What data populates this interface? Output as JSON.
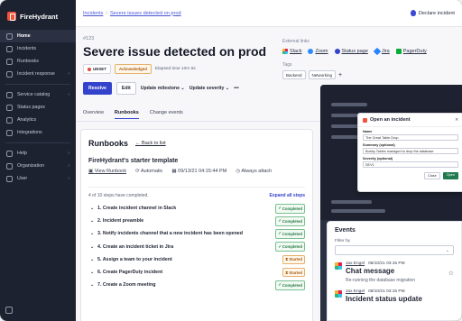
{
  "brand": {
    "name": "FireHydrant"
  },
  "sidebar": {
    "items": [
      {
        "label": "Home",
        "chevron": false,
        "active": true,
        "icon": "home-icon"
      },
      {
        "label": "Incidents",
        "chevron": false,
        "active": false,
        "icon": "incidents-icon"
      },
      {
        "label": "Runbooks",
        "chevron": false,
        "active": false,
        "icon": "runbooks-icon"
      },
      {
        "label": "Incident response",
        "chevron": true,
        "active": false,
        "icon": "response-icon"
      },
      {
        "label": "Service catalog",
        "chevron": true,
        "active": false,
        "icon": "catalog-icon"
      },
      {
        "label": "Status pages",
        "chevron": false,
        "active": false,
        "icon": "status-pages-icon"
      },
      {
        "label": "Analytics",
        "chevron": false,
        "active": false,
        "icon": "analytics-icon"
      },
      {
        "label": "Integrations",
        "chevron": false,
        "active": false,
        "icon": "integrations-icon"
      },
      {
        "label": "Help",
        "chevron": true,
        "active": false,
        "icon": "help-icon"
      },
      {
        "label": "Organization",
        "chevron": true,
        "active": false,
        "icon": "organization-icon"
      },
      {
        "label": "User",
        "chevron": true,
        "active": false,
        "icon": "user-icon"
      }
    ]
  },
  "topbar": {
    "crumb_root": "Incidents",
    "crumb_sep": "/",
    "crumb_current": "Severe issues detected on prod",
    "declare_label": "Declare incident"
  },
  "incident": {
    "number": "#123",
    "title": "Severe issue detected on prod",
    "severity": "UNSET",
    "status": "Acknowledged",
    "elapsed": "Elapsed time 10m 5s"
  },
  "actions": {
    "resolve": "Resolve",
    "edit": "Edit",
    "milestone": "Update milestone",
    "severity": "Update severity",
    "more": "•••"
  },
  "external": {
    "title": "External links",
    "links": [
      "Slack",
      "Zoom",
      "Status page",
      "Jira",
      "PagerDuty"
    ],
    "tags_title": "Tags",
    "tags": [
      "Backend",
      "Networking"
    ],
    "add": "+"
  },
  "tabs": [
    "Overview",
    "Runbooks",
    "Change events"
  ],
  "runbook": {
    "card_title": "Runbooks",
    "back": "Back to list",
    "name": "FireHydrant's starter template",
    "view": "View Runbook",
    "mode": "Automatic",
    "date": "09/13/21 04:15:44 PM",
    "attach": "Always attach",
    "progress": "4 of 10 steps have completed.",
    "expand": "Expand all steps",
    "steps": [
      {
        "label": "1. Create incident channel in Slack",
        "status": "Completed"
      },
      {
        "label": "2. Incident preamble",
        "status": "Completed"
      },
      {
        "label": "3. Notify incidents channel that a new incident has been opened",
        "status": "Completed"
      },
      {
        "label": "4. Create an incident ticket in Jira",
        "status": "Completed"
      },
      {
        "label": "5. Assign a team to your incident",
        "status": "Started"
      },
      {
        "label": "6. Create PagerDuty incident",
        "status": "Started"
      },
      {
        "label": "7. Create a Zoom meeting",
        "status": "Completed"
      }
    ]
  },
  "modal": {
    "title": "Open an incident",
    "name_label": "Name",
    "name_value": "The Great Table Drop",
    "summary_label": "Summary (optional)",
    "summary_value": "Bobby Tables managed to drop the database",
    "severity_label": "Severity (optional)",
    "severity_value": "SEV1",
    "close": "Close",
    "open": "Open"
  },
  "events": {
    "title": "Events",
    "filter_label": "Filter by",
    "items": [
      {
        "who": "Jax Engel",
        "when": "08/10/21 03:15 PM",
        "head": "Chat message",
        "sub": "Re-running the database migration"
      },
      {
        "who": "Jax Engel",
        "when": "08/10/21 03:15 PM",
        "head": "Incident status update",
        "sub": ""
      }
    ]
  }
}
